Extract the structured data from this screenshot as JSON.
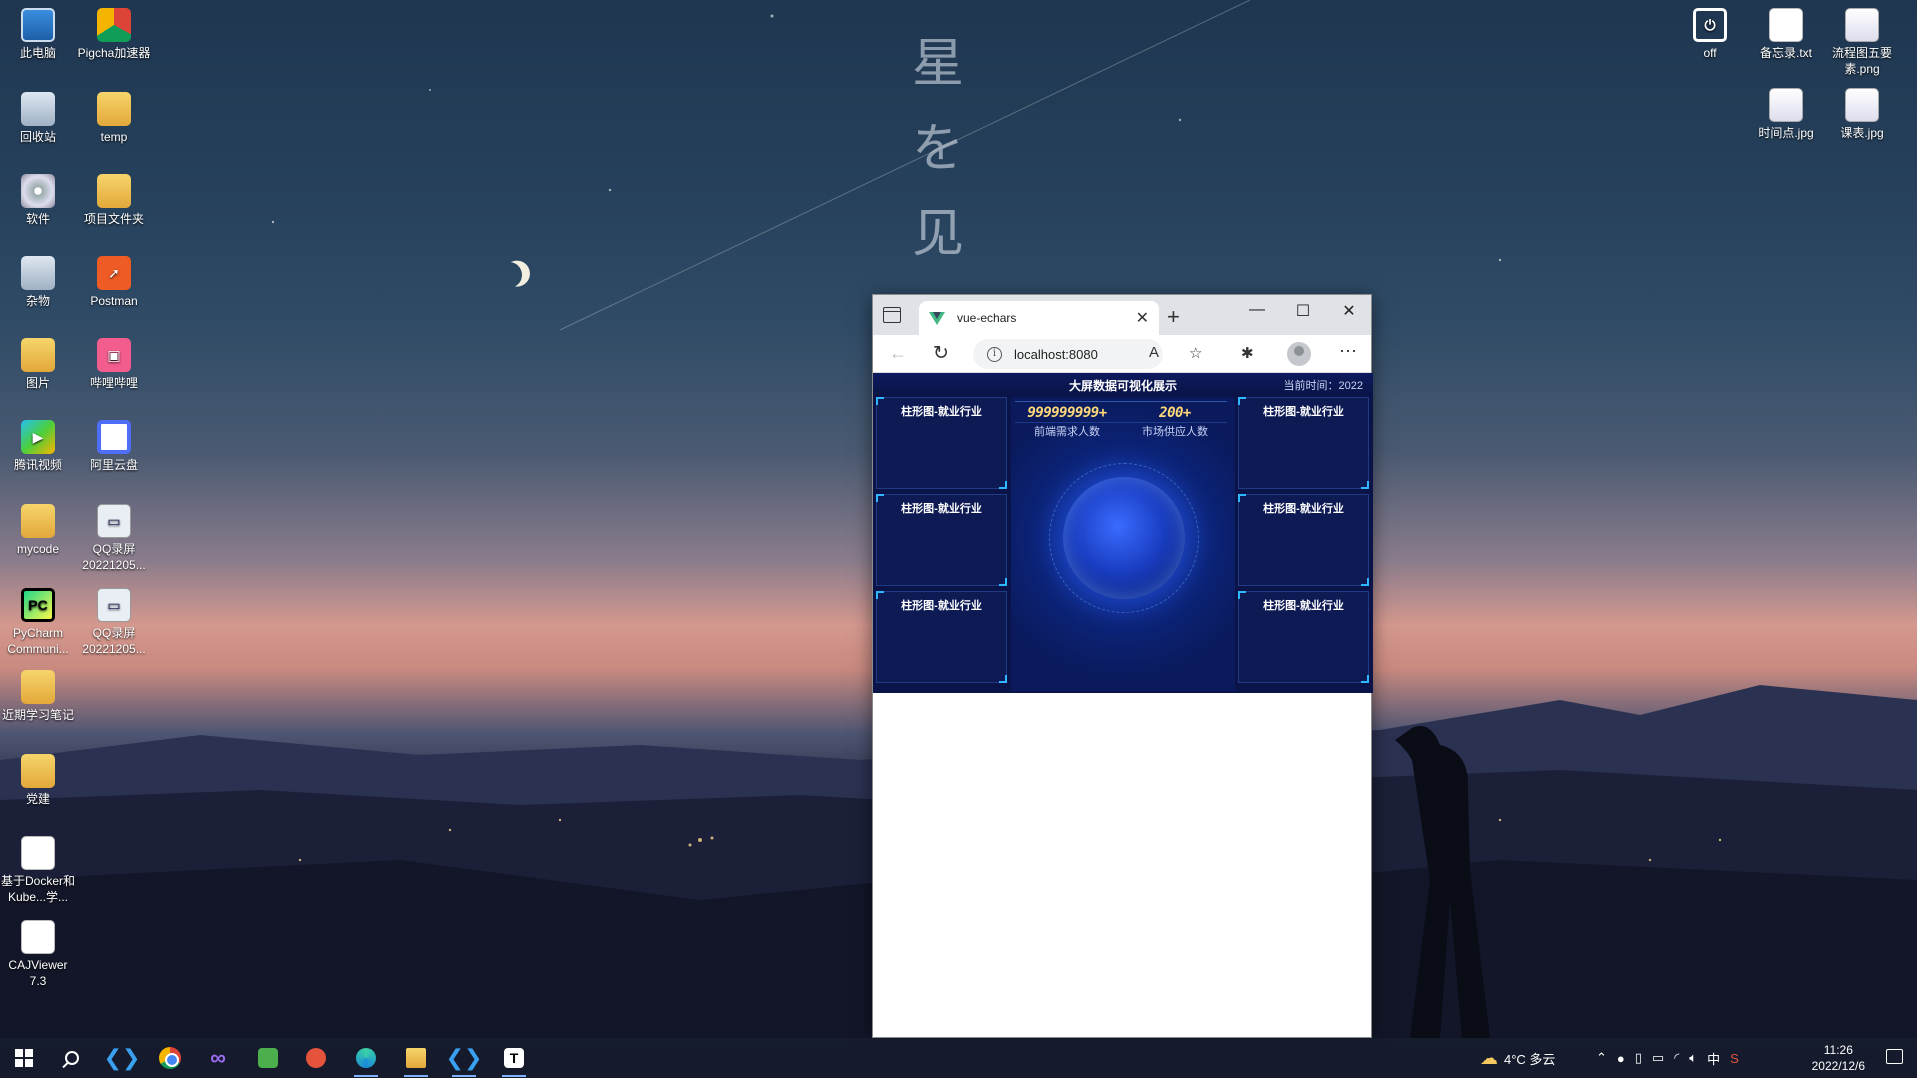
{
  "wallpaper": {
    "decor_chars": [
      "星",
      "を",
      "见"
    ]
  },
  "desktop_left": [
    {
      "label": "此电脑",
      "icon": "computer-icon"
    },
    {
      "label": "Pigcha加速器",
      "icon": "pigcha-icon"
    },
    {
      "label": "回收站",
      "icon": "recycle-bin-icon"
    },
    {
      "label": "temp",
      "icon": "folder-icon"
    },
    {
      "label": "软件",
      "icon": "dvd-drive-icon"
    },
    {
      "label": "项目文件夹",
      "icon": "folder-icon"
    },
    {
      "label": "杂物",
      "icon": "drive-icon"
    },
    {
      "label": "Postman",
      "icon": "postman-icon"
    },
    {
      "label": "图片",
      "icon": "folder-icon"
    },
    {
      "label": "哔哩哔哩",
      "icon": "bilibili-icon"
    },
    {
      "label": "腾讯视频",
      "icon": "tencent-video-icon"
    },
    {
      "label": "阿里云盘",
      "icon": "aliyun-drive-icon"
    },
    {
      "label": "mycode",
      "icon": "folder-icon"
    },
    {
      "label": "QQ录屏20221205...",
      "icon": "video-file-icon"
    },
    {
      "label": "PyCharm Communi...",
      "icon": "pycharm-icon"
    },
    {
      "label": "QQ录屏20221205...",
      "icon": "video-file-icon"
    },
    {
      "label": "近期学习笔记",
      "icon": "folder-icon"
    },
    {
      "label": "党建",
      "icon": "folder-icon"
    },
    {
      "label": "基于Docker和Kube...学...",
      "icon": "document-icon"
    },
    {
      "label": "CAJViewer 7.3",
      "icon": "document-icon"
    }
  ],
  "desktop_right": [
    {
      "label": "off",
      "icon": "power-icon"
    },
    {
      "label": "备忘录.txt",
      "icon": "text-file-icon"
    },
    {
      "label": "流程图五要素.png",
      "icon": "image-file-icon"
    },
    {
      "label": "时间点.jpg",
      "icon": "image-file-icon"
    },
    {
      "label": "课表.jpg",
      "icon": "image-file-icon"
    }
  ],
  "browser": {
    "tab_title": "vue-echars",
    "url": "localhost:8080",
    "controls": {
      "minimize": "—",
      "maximize": "☐",
      "close": "✕",
      "new_tab": "+",
      "tab_close": "✕",
      "more": "···"
    }
  },
  "dashboard": {
    "title": "大屏数据可视化展示",
    "time_label": "当前时间：2022",
    "stats": [
      {
        "value": "999999999+",
        "label": "前端需求人数"
      },
      {
        "value": "200+",
        "label": "市场供应人数"
      }
    ],
    "left_panels": [
      "柱形图-就业行业",
      "柱形图-就业行业",
      "柱形图-就业行业"
    ],
    "right_panels": [
      "柱形图-就业行业",
      "柱形图-就业行业",
      "柱形图-就业行业"
    ]
  },
  "taskbar": {
    "apps": [
      "start-icon",
      "search-icon",
      "vscode-icon",
      "chrome-icon",
      "visual-studio-icon",
      "app-green-icon",
      "app-red-icon",
      "edge-icon",
      "file-explorer-icon",
      "vscode-icon",
      "typora-icon"
    ],
    "weather": "4°C 多云",
    "time": "11:26",
    "date": "2022/12/6"
  }
}
